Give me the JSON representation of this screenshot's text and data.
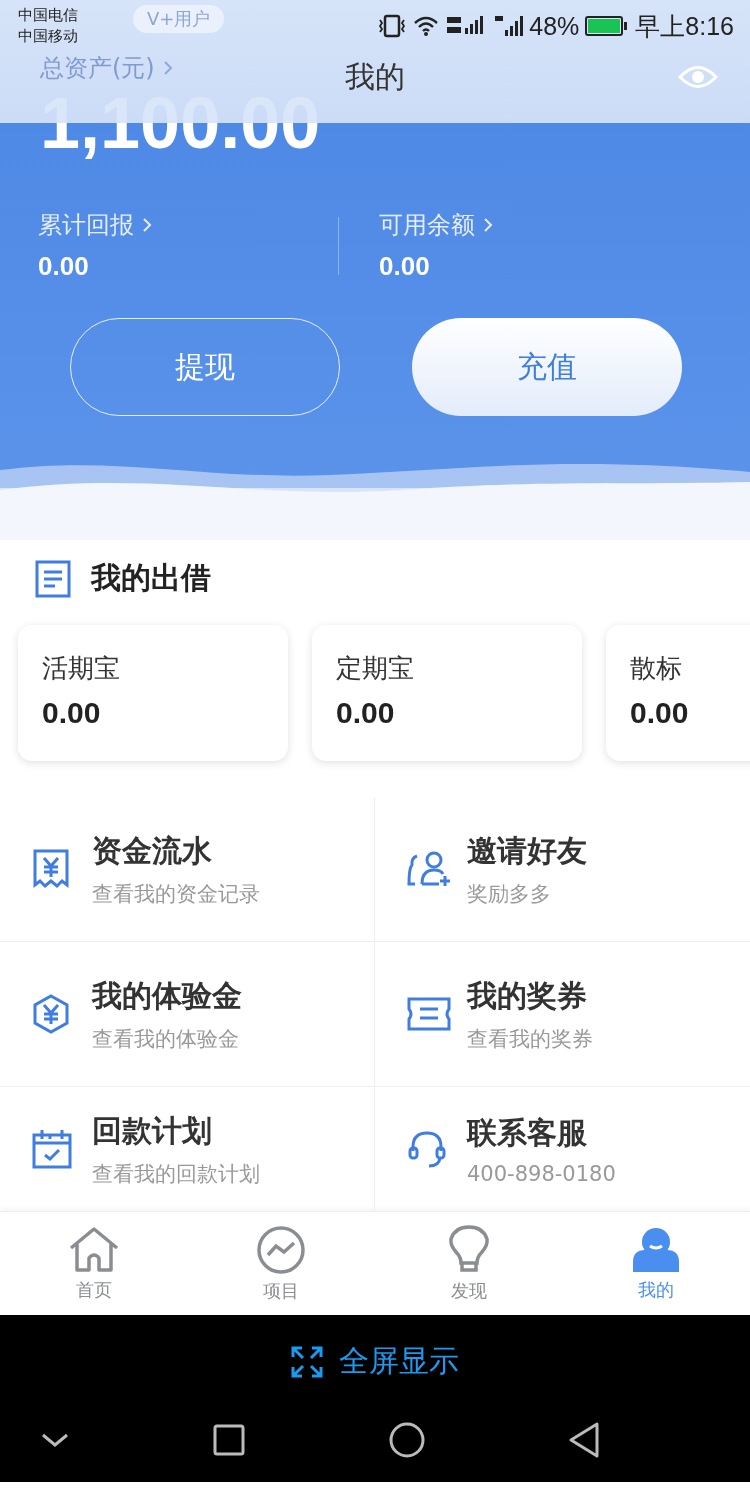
{
  "status_bar": {
    "carriers": [
      "中国电信",
      "中国移动"
    ],
    "battery_text": "48%",
    "time": "早上8:16"
  },
  "header": {
    "title": "我的",
    "badge": "V+用户"
  },
  "assets": {
    "label": "总资产(元)",
    "amount": "1,100.00",
    "stats": [
      {
        "label": "累计回报",
        "value": "0.00"
      },
      {
        "label": "可用余额",
        "value": "0.00"
      }
    ],
    "buttons": [
      {
        "label": "提现",
        "kind": "outline"
      },
      {
        "label": "充值",
        "kind": "filled"
      }
    ]
  },
  "lending": {
    "title": "我的出借",
    "cards": [
      {
        "label": "活期宝",
        "value": "0.00"
      },
      {
        "label": "定期宝",
        "value": "0.00"
      },
      {
        "label": "散标",
        "value": "0.00"
      }
    ]
  },
  "menu": [
    {
      "kind": "receipt",
      "title": "资金流水",
      "subtitle": "查看我的资金记录"
    },
    {
      "kind": "invite",
      "title": "邀请好友",
      "subtitle": "奖励多多"
    },
    {
      "kind": "hexagon",
      "title": "我的体验金",
      "subtitle": "查看我的体验金"
    },
    {
      "kind": "ticket",
      "title": "我的奖券",
      "subtitle": "查看我的奖券"
    },
    {
      "kind": "calendar",
      "title": "回款计划",
      "subtitle": "查看我的回款计划"
    },
    {
      "kind": "headset",
      "title": "联系客服",
      "subtitle": "400-898-0180"
    }
  ],
  "tabs": [
    {
      "kind": "home",
      "label": "首页",
      "selected": false
    },
    {
      "kind": "chart",
      "label": "项目",
      "selected": false
    },
    {
      "kind": "bulb",
      "label": "发现",
      "selected": false
    },
    {
      "kind": "user",
      "label": "我的",
      "selected": true
    }
  ],
  "fullscreen": {
    "label": "全屏显示"
  }
}
